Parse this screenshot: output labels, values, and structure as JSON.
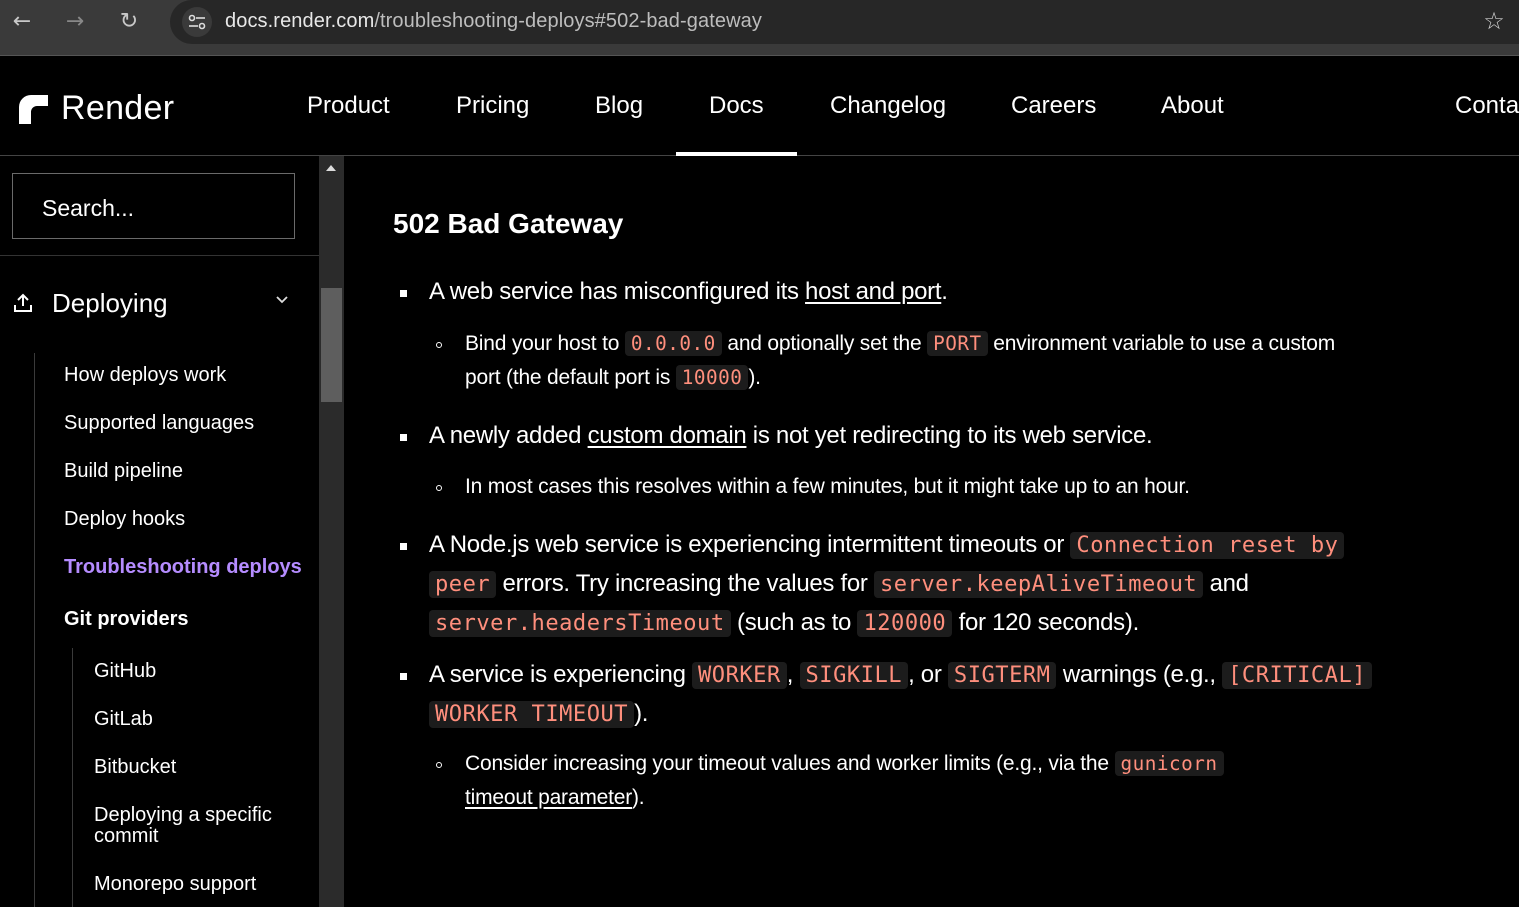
{
  "browser": {
    "url_host": "docs.render.com",
    "url_path": "/troubleshooting-deploys#502-bad-gateway"
  },
  "header": {
    "brand": "Render",
    "nav": [
      "Product",
      "Pricing",
      "Blog",
      "Docs",
      "Changelog",
      "Careers",
      "About",
      "Conta"
    ],
    "active": "Docs"
  },
  "sidebar": {
    "search_placeholder": "Search...",
    "section": "Deploying",
    "items": [
      "How deploys work",
      "Supported languages",
      "Build pipeline",
      "Deploy hooks",
      "Troubleshooting deploys"
    ],
    "group": "Git providers",
    "subitems": [
      "GitHub",
      "GitLab",
      "Bitbucket",
      "Deploying a specific commit",
      "Monorepo support"
    ]
  },
  "content": {
    "heading": "502 Bad Gateway",
    "b1": {
      "pre": "A web service has misconfigured its ",
      "link": "host and port",
      "post": "."
    },
    "b1s": {
      "t1": "Bind your host to ",
      "c1": "0.0.0.0",
      "t2": " and optionally set the ",
      "c2": "PORT",
      "t3": " environment variable to use a custom",
      "t4": "port (the default port is ",
      "c3": "10000",
      "t5": ")."
    },
    "b2": {
      "pre": "A newly added ",
      "link": "custom domain",
      "post": " is not yet redirecting to its web service."
    },
    "b2s": "In most cases this resolves within a few minutes, but it might take up to an hour.",
    "b3": {
      "t1": "A Node.js web service is experiencing intermittent timeouts or ",
      "c1a": "Connection reset by",
      "c1b": "peer",
      "t2": " errors. Try increasing the values for ",
      "c2": "server.keepAliveTimeout",
      "t3": " and",
      "c3": "server.headersTimeout",
      "t4": " (such as to ",
      "c4": "120000",
      "t5": " for 120 seconds)."
    },
    "b4": {
      "t1": "A service is experiencing ",
      "c1": "WORKER",
      "t2": ", ",
      "c2": "SIGKILL",
      "t3": ", or ",
      "c3": "SIGTERM",
      "t4": " warnings (e.g., ",
      "c4a": "[CRITICAL]",
      "c4b": "WORKER TIMEOUT",
      "t5": ")."
    },
    "b4s": {
      "t1": "Consider increasing your timeout values and worker limits (e.g., via the ",
      "c1": "gunicorn",
      "link": "timeout parameter",
      "t2": ")."
    }
  }
}
